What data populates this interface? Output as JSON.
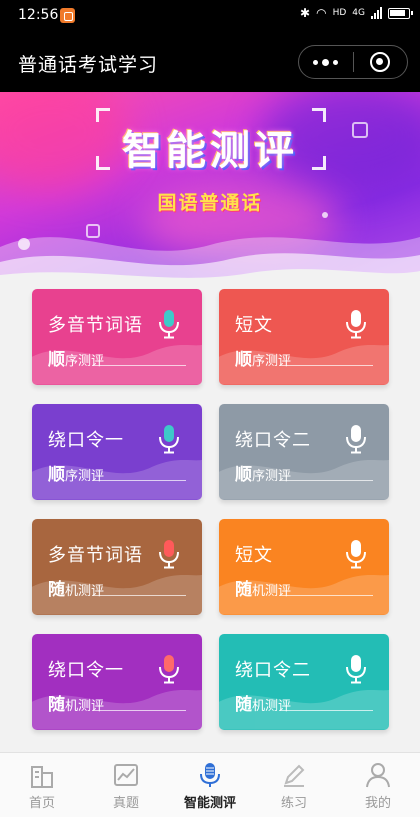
{
  "status_bar": {
    "time": "12:56",
    "network": "4G",
    "network_hd": "HD"
  },
  "title_bar": {
    "title": "普通话考试学习"
  },
  "banner": {
    "heading": "智能测评",
    "subheading": "国语普通话"
  },
  "cards": [
    {
      "name": "多音节词语",
      "mode_lead": "顺",
      "mode_rest": "序测评",
      "color": "#e8418f",
      "mic_color": "#3ec9c9"
    },
    {
      "name": "短文",
      "mode_lead": "顺",
      "mode_rest": "序测评",
      "color": "#ee5751",
      "mic_color": "#ffffff"
    },
    {
      "name": "绕口令一",
      "mode_lead": "顺",
      "mode_rest": "序测评",
      "color": "#7a3fcf",
      "mic_color": "#3ec9c9"
    },
    {
      "name": "绕口令二",
      "mode_lead": "顺",
      "mode_rest": "序测评",
      "color": "#8e9aa6",
      "mic_color": "#ffffff"
    },
    {
      "name": "多音节词语",
      "mode_lead": "随",
      "mode_rest": "机测评",
      "color": "#a8663f",
      "mic_color": "#ff5a5a"
    },
    {
      "name": "短文",
      "mode_lead": "随",
      "mode_rest": "机测评",
      "color": "#fa8421",
      "mic_color": "#ffffff"
    },
    {
      "name": "绕口令一",
      "mode_lead": "随",
      "mode_rest": "机测评",
      "color": "#a22fc0",
      "mic_color": "#ff6a6a"
    },
    {
      "name": "绕口令二",
      "mode_lead": "随",
      "mode_rest": "机测评",
      "color": "#23bdb5",
      "mic_color": "#ffffff"
    }
  ],
  "tabs": [
    {
      "label": "首页",
      "icon": "building-icon",
      "active": false
    },
    {
      "label": "真题",
      "icon": "chart-icon",
      "active": false
    },
    {
      "label": "智能测评",
      "icon": "microphone-icon",
      "active": true
    },
    {
      "label": "练习",
      "icon": "pencil-icon",
      "active": false
    },
    {
      "label": "我的",
      "icon": "user-icon",
      "active": false
    }
  ]
}
